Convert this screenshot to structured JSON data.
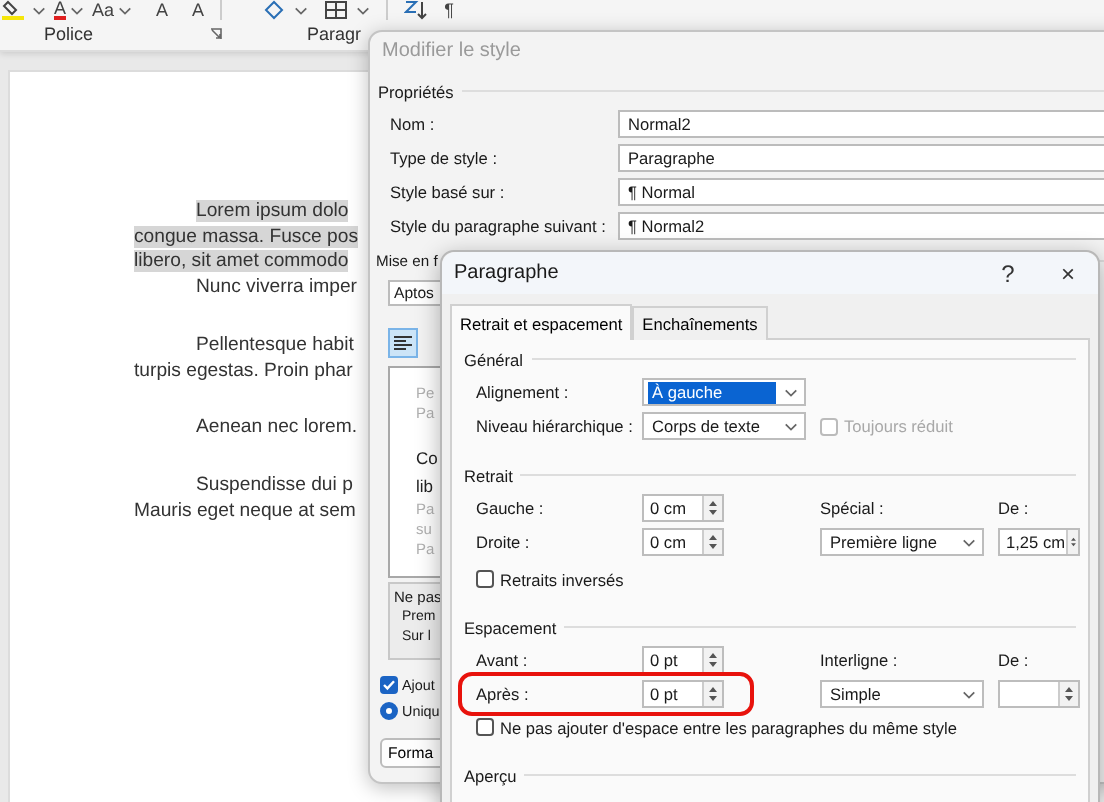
{
  "ribbon": {
    "font_buttons": [
      {
        "kind": "color",
        "text": "A"
      },
      {
        "kind": "dropdown",
        "text": "Aa"
      },
      {
        "kind": "plain",
        "text": "A"
      },
      {
        "kind": "plain",
        "text": "A"
      }
    ],
    "groups": [
      "Police",
      "Paragr"
    ],
    "pilcrow": "¶"
  },
  "document": {
    "blocks": [
      {
        "paragraphs": [
          {
            "lines": [
              "Lorem ipsum dolo",
              "congue massa. Fusce pos",
              "libero, sit amet commodo"
            ],
            "highlighted": true
          },
          {
            "lines": [
              "Nunc viverra imper"
            ],
            "highlighted": false
          }
        ]
      },
      {
        "paragraphs": [
          {
            "lines": [
              "Pellentesque habit",
              "turpis egestas. Proin phar"
            ],
            "highlighted": false
          }
        ]
      },
      {
        "paragraphs": [
          {
            "lines": [
              "Aenean nec lorem."
            ],
            "highlighted": false
          }
        ]
      },
      {
        "paragraphs": [
          {
            "lines": [
              "Suspendisse dui p",
              "Mauris eget neque at sem"
            ],
            "highlighted": false
          }
        ]
      }
    ]
  },
  "style_dialog": {
    "title": "Modifier le style",
    "section": "Propriétés",
    "properties": [
      {
        "label": "Nom :",
        "value": "Normal2"
      },
      {
        "label": "Type de style :",
        "value": "Paragraphe"
      },
      {
        "label": "Style basé sur :",
        "value": "¶  Normal"
      },
      {
        "label": "Style du paragraphe suivant :",
        "value": "¶  Normal2"
      }
    ],
    "format_heading": "Mise en f",
    "font": "Aptos",
    "preview_lines": [
      {
        "kind": "context",
        "text": "Pe"
      },
      {
        "kind": "context",
        "text": "Pa"
      },
      {
        "kind": "sample",
        "text": "Co"
      },
      {
        "kind": "sample",
        "text": "lib"
      },
      {
        "kind": "context",
        "text": "Pa"
      },
      {
        "kind": "context",
        "text": "su"
      },
      {
        "kind": "context",
        "text": "Pa"
      }
    ],
    "description_lines": [
      "Ne pas",
      "Prem",
      "Sur l"
    ],
    "add_to_gallery": {
      "label": "Ajout",
      "checked": true
    },
    "scope": {
      "label": "Uniqu",
      "selected": true
    },
    "format_button": "Forma"
  },
  "paragraph_dialog": {
    "title": "Paragraphe",
    "help": "?",
    "close": "×",
    "tabs": [
      {
        "label": "Retrait et espacement",
        "selected": true
      },
      {
        "label": "Enchaînements",
        "selected": false
      }
    ],
    "general": {
      "heading": "Général",
      "alignment": {
        "label": "Alignement :",
        "value": "À gauche",
        "focused": true
      },
      "outline_level": {
        "label": "Niveau hiérarchique :",
        "value": "Corps de texte"
      },
      "collapsed": {
        "label": "Toujours réduit",
        "checked": false,
        "disabled": true
      }
    },
    "indent": {
      "heading": "Retrait",
      "left": {
        "label": "Gauche :",
        "value": "0 cm"
      },
      "right": {
        "label": "Droite :",
        "value": "0 cm"
      },
      "special": {
        "label": "Spécial :",
        "value": "Première ligne"
      },
      "by": {
        "label": "De :",
        "value": "1,25 cm"
      },
      "mirror": {
        "label": "Retraits inversés",
        "checked": false,
        "disabled": false
      }
    },
    "spacing": {
      "heading": "Espacement",
      "before": {
        "label": "Avant :",
        "value": "0 pt"
      },
      "after": {
        "label": "Après :",
        "value": "0 pt",
        "highlighted": true
      },
      "line_spacing": {
        "label": "Interligne :",
        "value": "Simple"
      },
      "at": {
        "label": "De :"
      },
      "no_space": {
        "label": "Ne pas ajouter d'espace entre les paragraphes du même style",
        "checked": false,
        "disabled": false
      }
    },
    "preview_heading": "Aperçu"
  }
}
